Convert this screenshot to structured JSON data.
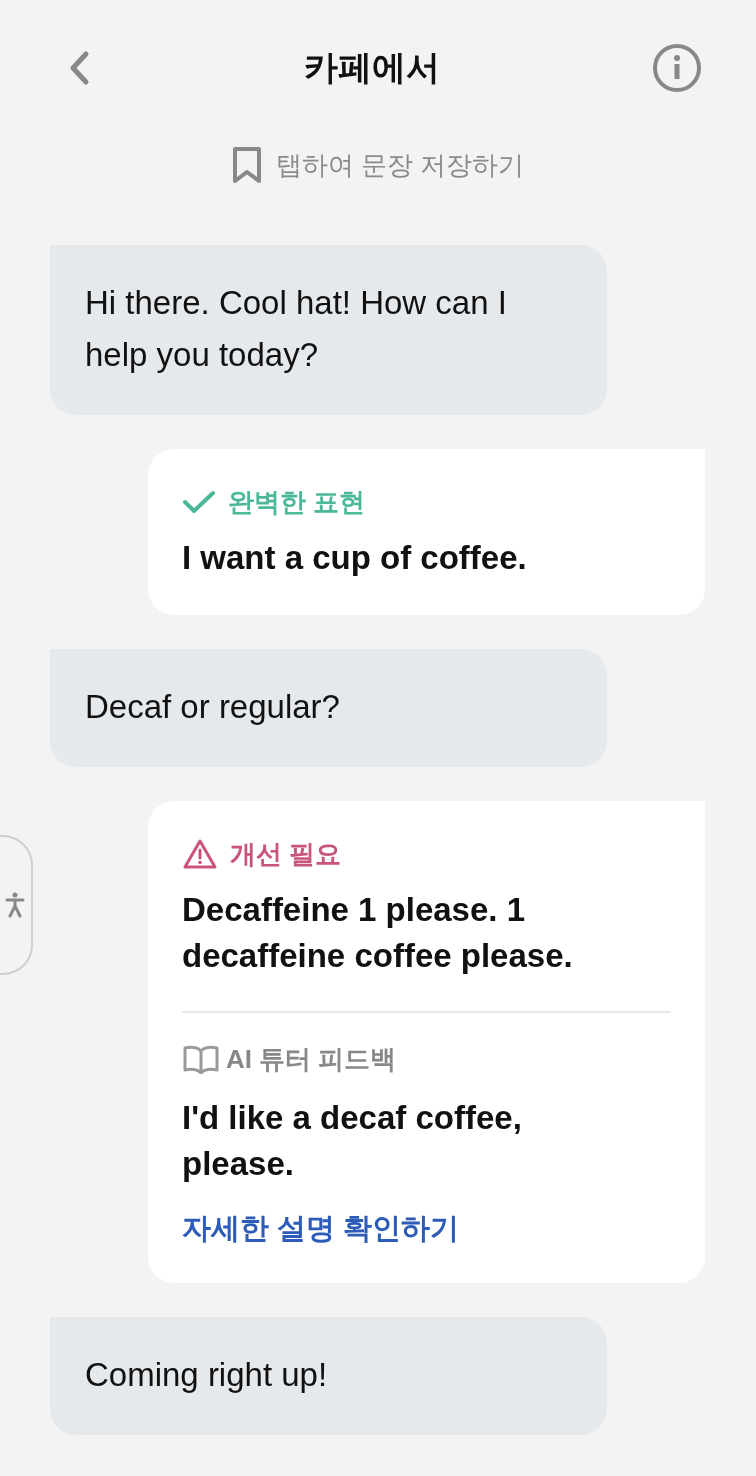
{
  "header": {
    "title": "카페에서"
  },
  "save_hint": {
    "label": "탭하여 문장 저장하기"
  },
  "messages": [
    {
      "kind": "bot",
      "text": "Hi there. Cool hat! How can I help you today?"
    },
    {
      "kind": "correct",
      "verdict_label": "완벽한 표현",
      "text": "I want a cup of coffee."
    },
    {
      "kind": "bot",
      "text": "Decaf or regular?"
    },
    {
      "kind": "needs_work",
      "verdict_label": "개선 필요",
      "text": "Decaffeine 1 please. 1 decaffeine coffee please.",
      "feedback": {
        "label": "AI 튜터 피드백",
        "text": "I'd like a decaf coffee, please.",
        "link": "자세한 설명 확인하기"
      }
    },
    {
      "kind": "bot",
      "text": "Coming right up!"
    }
  ]
}
